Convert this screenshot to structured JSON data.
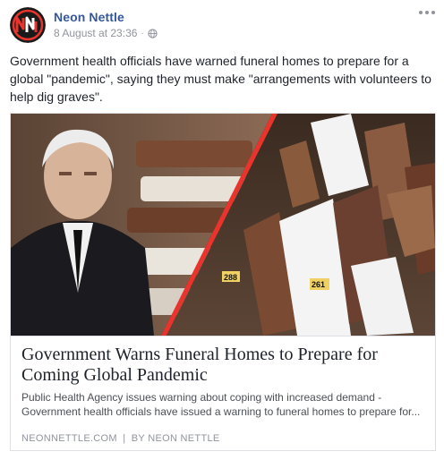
{
  "post": {
    "author": "Neon Nettle",
    "timestamp": "8 August at 23:36",
    "separator": "·",
    "text": "Government health officials have warned funeral homes to prepare for a global \"pandemic\", saying they must make \"arrangements with volunteers to help dig graves\".",
    "avatar_icon": "neon-nettle-logo",
    "more_icon": "ellipsis-icon",
    "privacy_icon": "globe-icon"
  },
  "card": {
    "title_line1": "Government Warns Funeral Homes to Prepare for",
    "title_line2": "Coming Global Pandemic",
    "desc_line1": "Public Health Agency issues warning about coping with increased demand -",
    "desc_line2": "Government health officials have issued a warning to funeral homes to prepare for...",
    "source": "NEONNETTLE.COM",
    "source_sep": "|",
    "by_label": "BY",
    "by_author": "NEON NETTLE",
    "coffin_label_1": "288",
    "coffin_label_2": "261"
  },
  "colors": {
    "author_link": "#365899",
    "meta_gray": "#90949c",
    "body_text": "#1d2129",
    "logo_red": "#e8342c"
  }
}
